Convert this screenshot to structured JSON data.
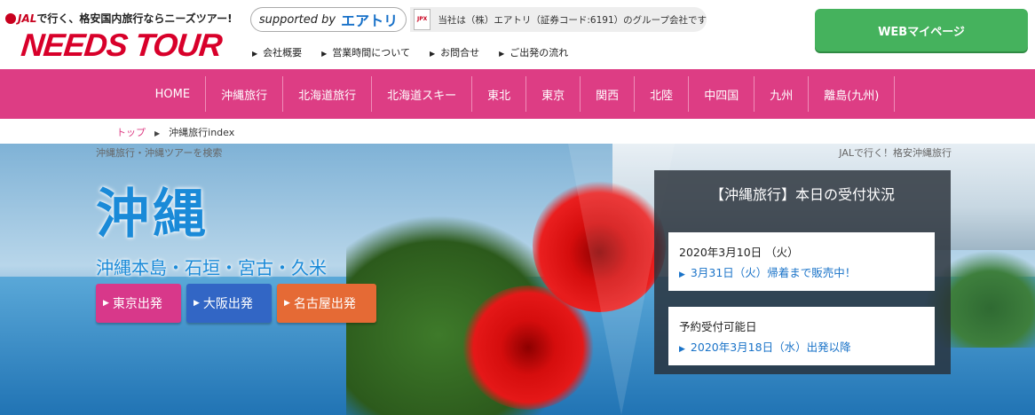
{
  "header": {
    "tagline_brand": "JAL",
    "tagline_rest": "で行く、格安国内旅行ならニーズツアー!",
    "logo_text": "NEEDS TOUR",
    "supported_label": "supported by",
    "supported_brand": "エアトリ",
    "group_text": "当社は（株）エアトリ（証券コード:6191）のグループ会社です",
    "links": [
      "会社概要",
      "営業時間について",
      "お問合せ",
      "ご出発の流れ"
    ],
    "mypage_label": "WEBマイページ"
  },
  "nav": {
    "items": [
      "HOME",
      "沖縄旅行",
      "北海道旅行",
      "北海道スキー",
      "東北",
      "東京",
      "関西",
      "北陸",
      "中四国",
      "九州",
      "離島(九州)"
    ]
  },
  "breadcrumb": {
    "top": "トップ",
    "current": "沖縄旅行index"
  },
  "hero": {
    "meta_left": "沖縄旅行・沖縄ツアーを検索",
    "meta_right": "JALで行く！格安沖縄旅行",
    "title": "沖縄",
    "subtitle": "沖縄本島・石垣・宮古・久米",
    "departures": {
      "tokyo": "東京出発",
      "osaka": "大阪出発",
      "nagoya": "名古屋出発"
    },
    "colors": {
      "tokyo": "#d8388a",
      "osaka": "#3266c5",
      "nagoya": "#e56a35",
      "nav": "#dd3d84",
      "mypage": "#45b25d"
    }
  },
  "status": {
    "title": "【沖縄旅行】本日の受付状況",
    "card1": {
      "date": "2020年3月10日 （火）",
      "note": "3月31日（火）帰着まで販売中！"
    },
    "card2": {
      "label": "予約受付可能日",
      "note": "2020年3月18日（水）出発以降"
    }
  },
  "icons": [
    "jal-crane-icon",
    "jpx-icon",
    "arrow-right-icon"
  ]
}
